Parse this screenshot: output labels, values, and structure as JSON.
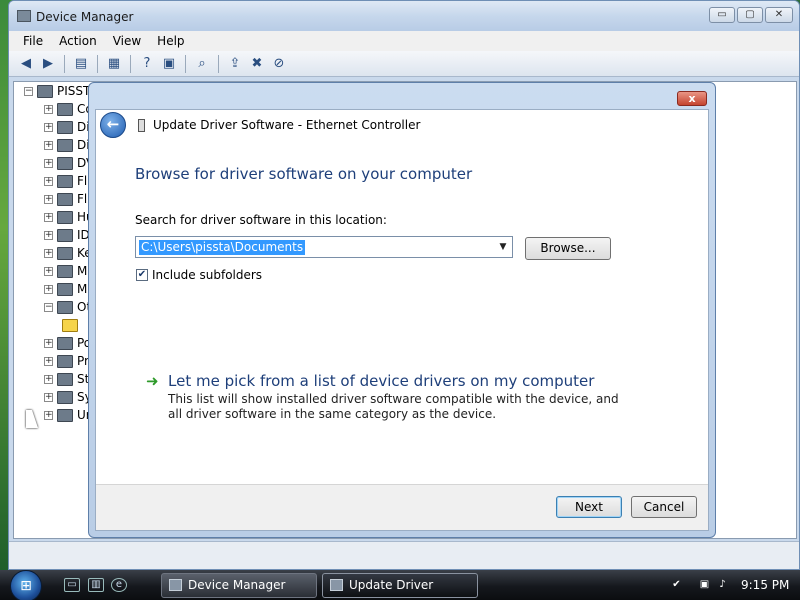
{
  "device_manager": {
    "title": "Device Manager",
    "window_buttons": {
      "minimize": "▭",
      "maximize": "▢",
      "close": "✕"
    },
    "menu": [
      "File",
      "Action",
      "View",
      "Help"
    ],
    "tree": {
      "root": "PISST",
      "items": [
        {
          "label": "Co",
          "expander": "+"
        },
        {
          "label": "Di",
          "expander": "+"
        },
        {
          "label": "Di",
          "expander": "+"
        },
        {
          "label": "DV",
          "expander": "+"
        },
        {
          "label": "Fl",
          "expander": "+"
        },
        {
          "label": "Fl",
          "expander": "+"
        },
        {
          "label": "Hu",
          "expander": "+"
        },
        {
          "label": "ID",
          "expander": "+"
        },
        {
          "label": "Ke",
          "expander": "+"
        },
        {
          "label": "Mi",
          "expander": "+"
        },
        {
          "label": "M",
          "expander": "+"
        },
        {
          "label": "Ot",
          "expander": "−"
        },
        {
          "label": "",
          "expander": ""
        },
        {
          "label": "Po",
          "expander": "+"
        },
        {
          "label": "Pr",
          "expander": "+"
        },
        {
          "label": "St",
          "expander": "+"
        },
        {
          "label": "Sy",
          "expander": "+"
        },
        {
          "label": "Ur",
          "expander": "+"
        }
      ]
    }
  },
  "dialog": {
    "title": "Update Driver Software - Ethernet Controller",
    "close_label": "x",
    "heading": "Browse for driver software on your computer",
    "search_label": "Search for driver software in this location:",
    "path_value": "C:\\Users\\pissta\\Documents",
    "browse_label": "Browse...",
    "include_subfolders_label": "Include subfolders",
    "include_subfolders_checked": true,
    "pick_link": "Let me pick from a list of device drivers on my computer",
    "pick_description": "This list will show installed driver software compatible with the device, and all driver software in the same category as the device.",
    "next_label": "Next",
    "cancel_label": "Cancel"
  },
  "taskbar": {
    "buttons": [
      {
        "label": "Device Manager",
        "active": false
      },
      {
        "label": "Update Driver Softw...",
        "active": true
      }
    ],
    "clock": "9:15 PM"
  }
}
